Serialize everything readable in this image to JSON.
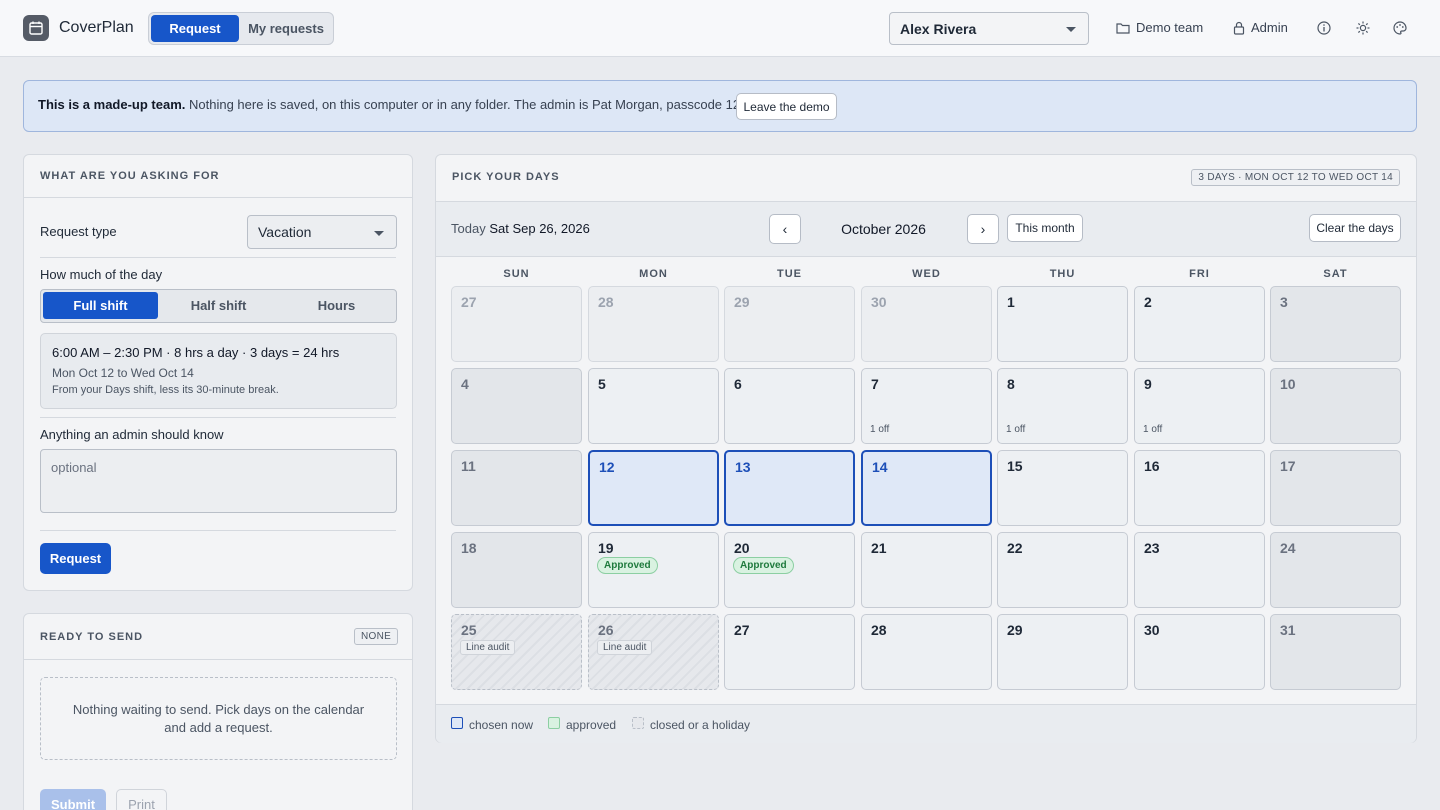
{
  "app": {
    "name": "CoverPlan"
  },
  "nav": {
    "tabs": [
      "Request",
      "My requests"
    ]
  },
  "user_select": {
    "value": "Alex Rivera"
  },
  "header_links": {
    "team": "Demo team",
    "admin": "Admin"
  },
  "banner": {
    "bold": "This is a made-up team.",
    "text": " Nothing here is saved, on this computer or in any folder. The admin is Pat Morgan, passcode 1234.",
    "button": "Leave the demo"
  },
  "request_panel": {
    "title": "WHAT ARE YOU ASKING FOR",
    "type_label": "Request type",
    "type_value": "Vacation",
    "amount_label": "How much of the day",
    "amount_options": [
      "Full shift",
      "Half shift",
      "Hours"
    ],
    "summary_main": "6:00 AM – 2:30 PM · 8 hrs a day · 3 days = 24 hrs",
    "summary_range": "Mon Oct 12 to Wed Oct 14",
    "summary_note": "From your Days shift, less its 30-minute break.",
    "note_label": "Anything an admin should know",
    "note_placeholder": "optional",
    "submit_label": "Request"
  },
  "ready_panel": {
    "title": "READY TO SEND",
    "tag": "NONE",
    "empty_text": "Nothing waiting to send. Pick days on the calendar and add a request.",
    "submit": "Submit",
    "print": "Print"
  },
  "calendar": {
    "title": "PICK YOUR DAYS",
    "selection_tag": "3 DAYS · MON OCT 12 TO WED OCT 14",
    "today_label": "Today",
    "today_value": "Sat Sep 26, 2026",
    "prev": "‹",
    "next": "›",
    "month": "October 2026",
    "this_month": "This month",
    "clear": "Clear the days",
    "weekdays": [
      "SUN",
      "MON",
      "TUE",
      "WED",
      "THU",
      "FRI",
      "SAT"
    ],
    "weeks": [
      [
        {
          "d": "27",
          "s": "out"
        },
        {
          "d": "28",
          "s": "out"
        },
        {
          "d": "29",
          "s": "out"
        },
        {
          "d": "30",
          "s": "out"
        },
        {
          "d": "1"
        },
        {
          "d": "2"
        },
        {
          "d": "3",
          "s": "weekend"
        }
      ],
      [
        {
          "d": "4",
          "s": "weekend"
        },
        {
          "d": "5"
        },
        {
          "d": "6"
        },
        {
          "d": "7",
          "off": "1 off"
        },
        {
          "d": "8",
          "off": "1 off"
        },
        {
          "d": "9",
          "off": "1 off"
        },
        {
          "d": "10",
          "s": "weekend"
        }
      ],
      [
        {
          "d": "11",
          "s": "weekend"
        },
        {
          "d": "12",
          "s": "chosen"
        },
        {
          "d": "13",
          "s": "chosen"
        },
        {
          "d": "14",
          "s": "chosen"
        },
        {
          "d": "15"
        },
        {
          "d": "16"
        },
        {
          "d": "17",
          "s": "weekend"
        }
      ],
      [
        {
          "d": "18",
          "s": "weekend"
        },
        {
          "d": "19",
          "badge": "Approved"
        },
        {
          "d": "20",
          "badge": "Approved"
        },
        {
          "d": "21"
        },
        {
          "d": "22"
        },
        {
          "d": "23"
        },
        {
          "d": "24",
          "s": "weekend"
        }
      ],
      [
        {
          "d": "25",
          "s": "closed",
          "tag": "Line audit"
        },
        {
          "d": "26",
          "s": "closed",
          "tag": "Line audit"
        },
        {
          "d": "27"
        },
        {
          "d": "28"
        },
        {
          "d": "29"
        },
        {
          "d": "30"
        },
        {
          "d": "31",
          "s": "weekend"
        }
      ]
    ],
    "legend": {
      "chosen": "chosen now",
      "approved": "approved",
      "closed": "closed or a holiday"
    }
  },
  "colors": {
    "accent": "#1756c9",
    "approved": "#1f7a3d",
    "banner": "#dde7f6"
  }
}
